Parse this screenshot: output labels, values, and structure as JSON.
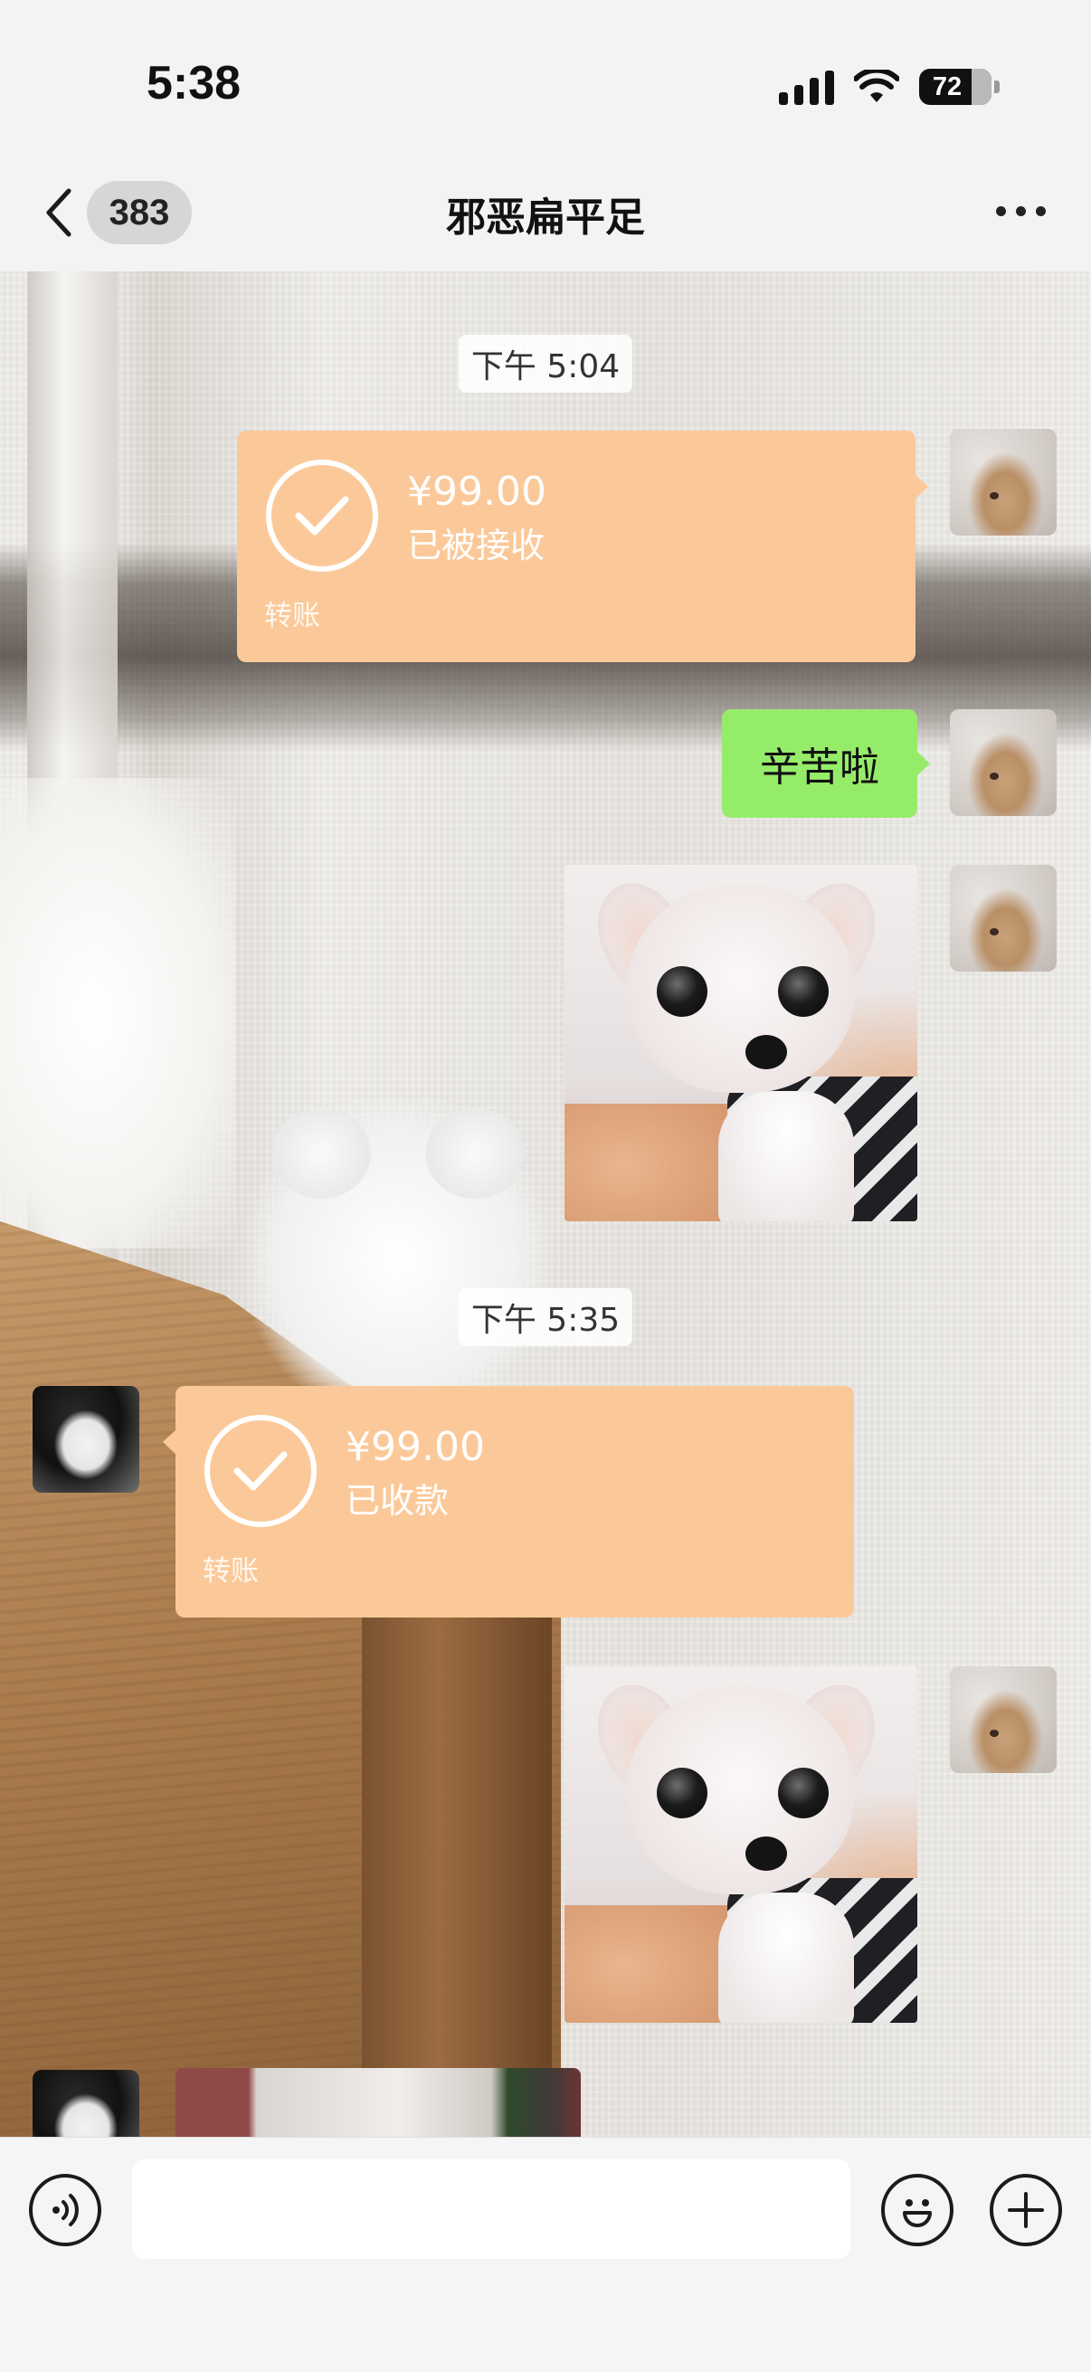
{
  "status_bar": {
    "time": "5:38",
    "battery": "72"
  },
  "nav": {
    "unread_count": "383",
    "title": "邪恶扁平足",
    "icons": [
      "back-chevron-icon",
      "more-icon"
    ]
  },
  "messages": {
    "ts1": "下午 5:04",
    "transfer1": {
      "amount": "¥99.00",
      "status": "已被接收",
      "kind": "转账"
    },
    "text1": "辛苦啦",
    "ts2": "下午 5:35",
    "transfer2": {
      "amount": "¥99.00",
      "status": "已收款",
      "kind": "转账"
    }
  },
  "composer": {
    "input_value": "",
    "icons": [
      "voice-icon",
      "emoji-icon",
      "plus-icon"
    ]
  },
  "colors": {
    "transfer_bubble": "#fbc999",
    "sent_bubble": "#95ec69"
  }
}
